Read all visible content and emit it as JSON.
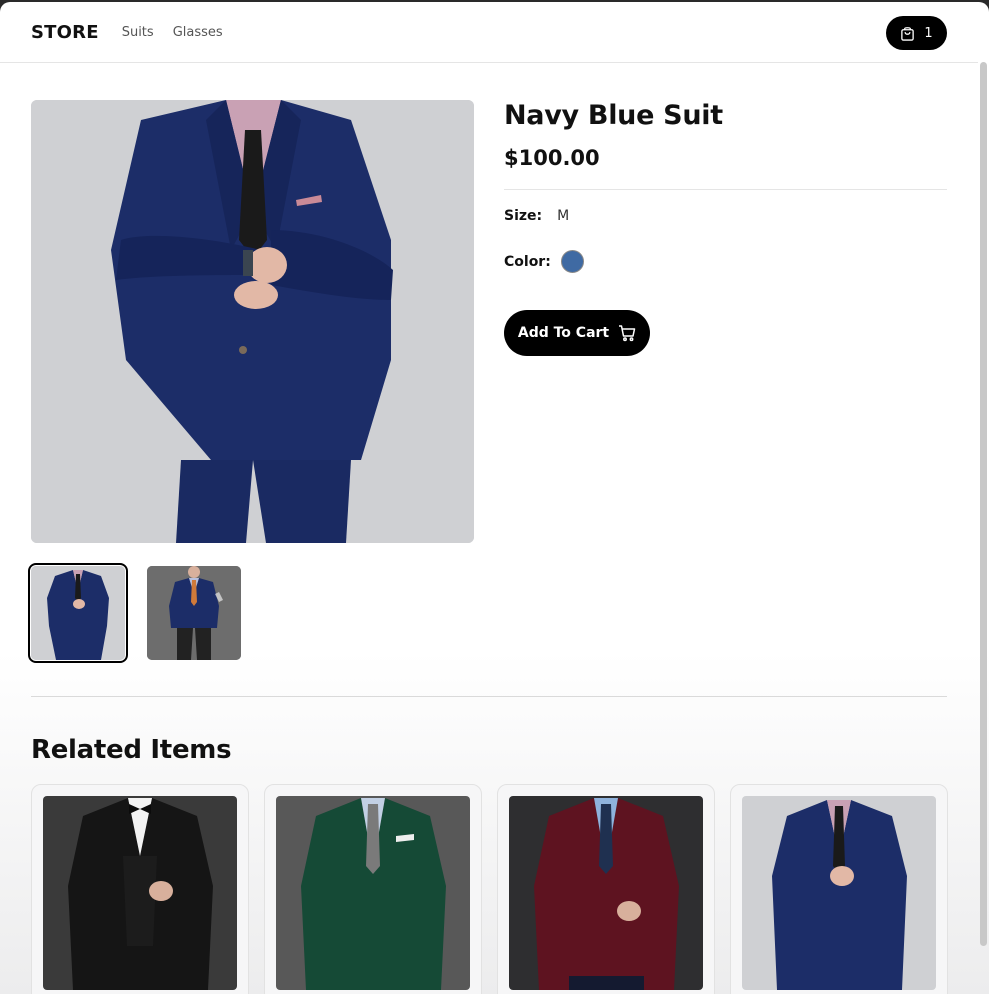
{
  "nav": {
    "logo": "STORE",
    "links": [
      "Suits",
      "Glasses"
    ],
    "cart_count": "1",
    "cart_icon": "shopping-bag-icon"
  },
  "product": {
    "title": "Navy Blue Suit",
    "price": "$100.00",
    "size_label": "Size:",
    "size_value": "M",
    "color_label": "Color:",
    "color_value": "#3f6aa3",
    "add_to_cart": "Add To Cart",
    "add_to_cart_icon": "shopping-cart-icon",
    "images": [
      "navy-suit-front",
      "navy-suit-full"
    ],
    "selected_image": 0
  },
  "related": {
    "heading": "Related Items",
    "items": [
      {
        "image": "black-tuxedo"
      },
      {
        "image": "green-suit"
      },
      {
        "image": "burgundy-blazer"
      },
      {
        "image": "navy-suit"
      }
    ]
  },
  "colors": {
    "accent": "#000000",
    "navy": "#1b2c66",
    "green": "#154a36",
    "burgundy": "#5e1320",
    "black": "#151515"
  }
}
